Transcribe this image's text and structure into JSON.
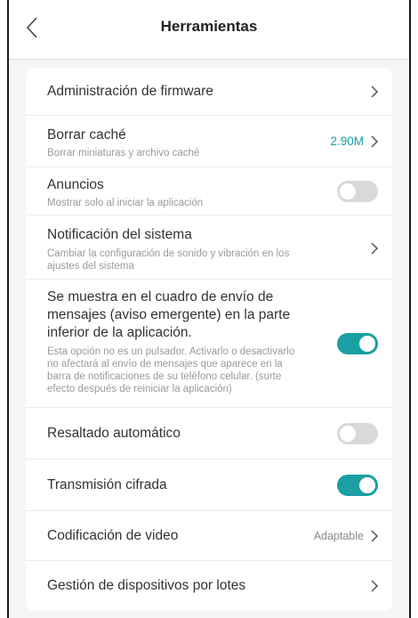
{
  "header": {
    "title": "Herramientas",
    "back_icon": "chevron-left-icon"
  },
  "colors": {
    "accent": "#1a9fa2",
    "toggle_off": "#d9d9d9",
    "value_cache": "#1a9fa2",
    "value_muted": "#8c8c8c"
  },
  "items": [
    {
      "label": "Administración de firmware",
      "control": "chevron"
    },
    {
      "label": "Borrar caché",
      "description": "Borrar miniaturas y archivo caché",
      "value": "2.90M",
      "control": "chevron"
    },
    {
      "label": "Anuncios",
      "description": "Mostrar solo al iniciar la aplicación",
      "control": "toggle",
      "on": false
    },
    {
      "label": "Notificación del sistema",
      "description_lines": [
        "Cambiar la configuración de sonido y vibración en los",
        "ajustes del sistema"
      ],
      "control": "chevron"
    },
    {
      "label_lines": [
        "Se muestra en el cuadro de envío de",
        "mensajes (aviso emergente) en la parte",
        "inferior de la aplicación."
      ],
      "description_lines": [
        "Esta opción no es un pulsador. Activarlo o desactivarlo",
        "no afectará al envío de mensajes que aparece en la",
        "barra de notificaciones de su teléfono celular. (surte",
        "efecto después de reiniciar la aplicación)"
      ],
      "control": "toggle",
      "on": true
    },
    {
      "label": "Resaltado automático",
      "control": "toggle",
      "on": false
    },
    {
      "label": "Transmisión cifrada",
      "control": "toggle",
      "on": true
    },
    {
      "label": "Codificación de video",
      "value": "Adaptable",
      "control": "chevron"
    },
    {
      "label": "Gestión de dispositivos por lotes",
      "control": "chevron"
    }
  ]
}
